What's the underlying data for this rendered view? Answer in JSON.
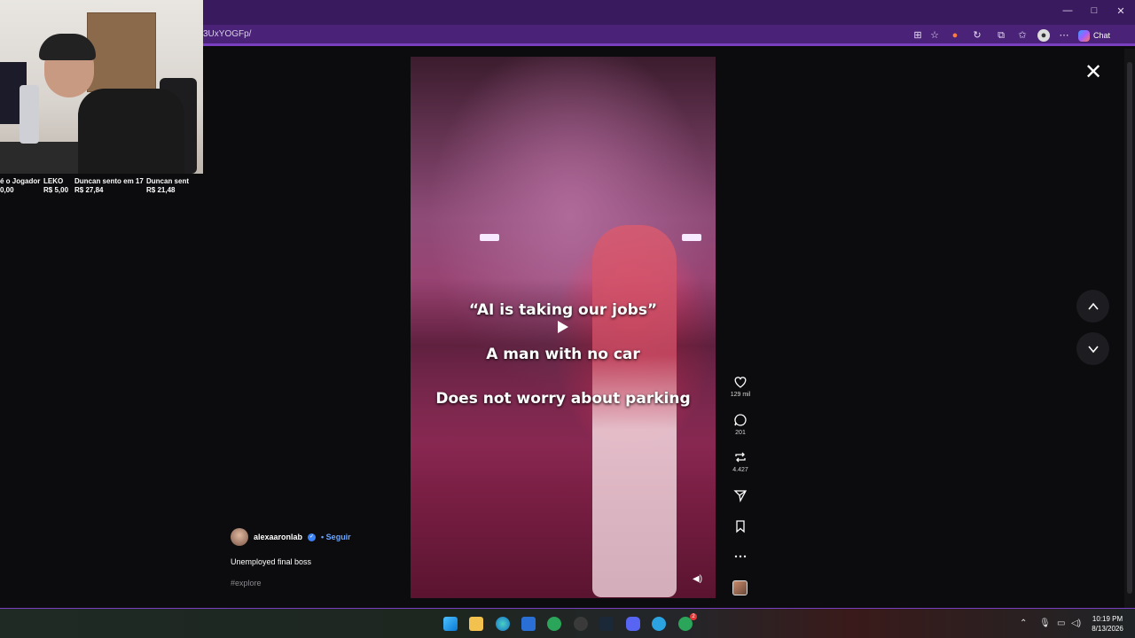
{
  "browser": {
    "url": "3UxYOGFp/",
    "chat_label": "Chat",
    "minimize": "—",
    "maximize": "□",
    "close": "✕"
  },
  "donations": [
    {
      "name": "é o Jogador",
      "amount": "0,00"
    },
    {
      "name": "LEKO",
      "amount": "R$ 5,00"
    },
    {
      "name": "Duncan sento em 17",
      "amount": "R$ 27,84"
    },
    {
      "name": "Duncan sent",
      "amount": "R$ 21,48"
    }
  ],
  "video": {
    "captions": [
      "“AI is taking our jobs”",
      "A man with no car",
      "Does not worry about parking"
    ]
  },
  "actions": {
    "likes": "129 mil",
    "comments": "201",
    "reposts": "4.427"
  },
  "post": {
    "username": "alexaaronlab",
    "follow_label": "• Seguir",
    "caption": "Unemployed final boss",
    "hashtag": "#explore"
  },
  "taskbar": {
    "time": "10:19 PM",
    "date": "8/13/2026",
    "badge_count": "2"
  },
  "colors": {
    "browser_frame": "#3a1a5e",
    "accent": "#7a3fc0",
    "follow_blue": "#6aa5ff"
  }
}
